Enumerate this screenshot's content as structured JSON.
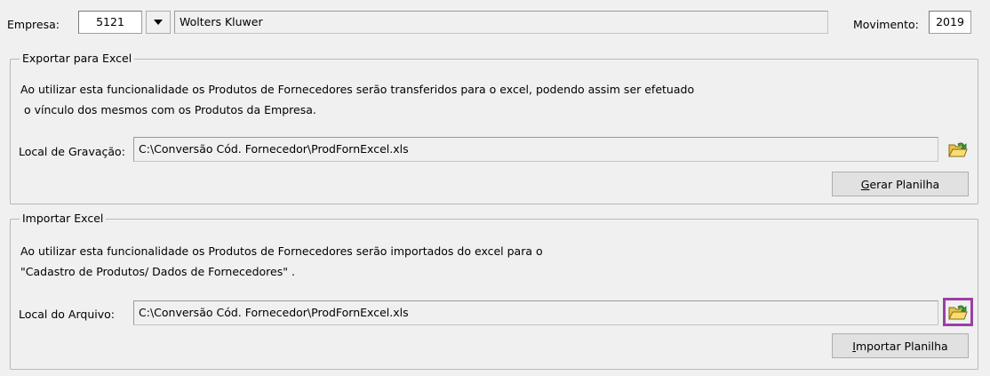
{
  "header": {
    "empresa_label": "Empresa:",
    "empresa_code": "5121",
    "empresa_name": "Wolters Kluwer",
    "movimento_label": "Movimento:",
    "movimento_value": "2019"
  },
  "exportar": {
    "title": "Exportar para Excel",
    "description_line1": "Ao utilizar esta funcionalidade os Produtos de Fornecedores serão transferidos para o excel, podendo assim ser efetuado",
    "description_line2": " o vínculo dos mesmos com os Produtos da Empresa.",
    "path_label": "Local de Gravação:",
    "path_value": "C:\\Conversão Cód. Fornecedor\\ProdFornExcel.xls",
    "button_first_letter": "G",
    "button_rest": "erar Planilha",
    "folder_icon": "open-folder-icon"
  },
  "importar": {
    "title": "Importar Excel",
    "description_line1": "Ao utilizar esta funcionalidade os Produtos de Fornecedores serão importados do excel para o",
    "description_line2": "\"Cadastro de Produtos/ Dados de Fornecedores\" .",
    "path_label": "Local do Arquivo:",
    "path_value": "C:\\Conversão Cód. Fornecedor\\ProdFornExcel.xls",
    "button_first_letter": "I",
    "button_rest": "mportar Planilha",
    "folder_icon": "open-folder-icon"
  },
  "colors": {
    "highlight": "#9b3fa6",
    "window_bg": "#f0f0f0"
  }
}
